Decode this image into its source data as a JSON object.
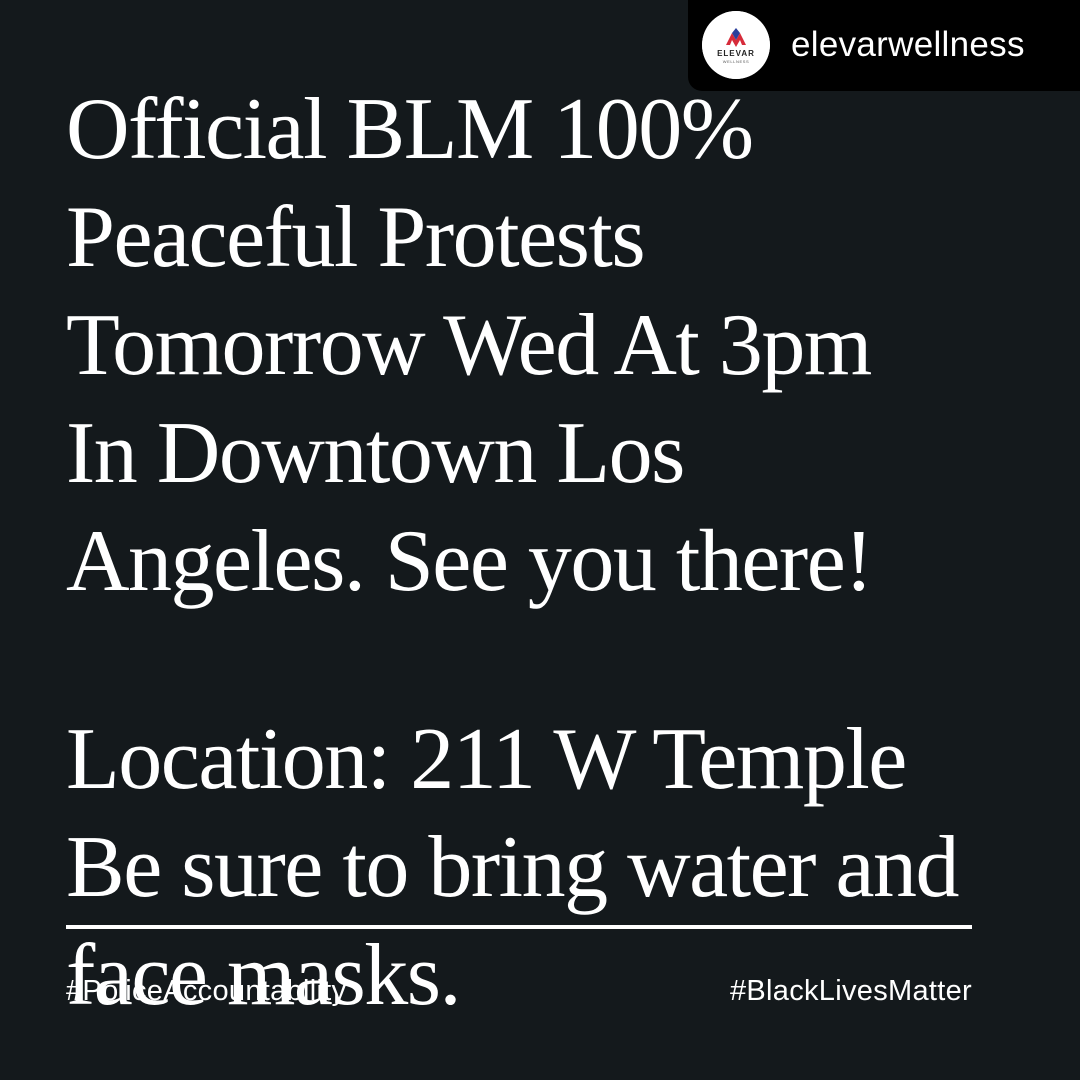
{
  "repost": {
    "handle": "elevarwellness",
    "avatar_icon": "elevar-wellness-logo",
    "logo_text": "ELEVAR",
    "logo_subtext": "WELLNESS"
  },
  "message": {
    "lines": [
      "Official BLM 100%",
      "Peaceful Protests",
      "Tomorrow Wed At 3pm",
      "In Downtown Los",
      "Angeles. See you there!"
    ],
    "location_lines": [
      "Location: 211 W Temple",
      "Be sure to bring water and",
      "face masks."
    ]
  },
  "hashtags": {
    "left": "#PoliceAccountability",
    "right": "#BlackLivesMatter"
  },
  "colors": {
    "background": "#14191c",
    "text": "#ffffff",
    "badge": "#000000",
    "logo_red": "#d62b3a",
    "logo_blue": "#2a3f9c"
  }
}
